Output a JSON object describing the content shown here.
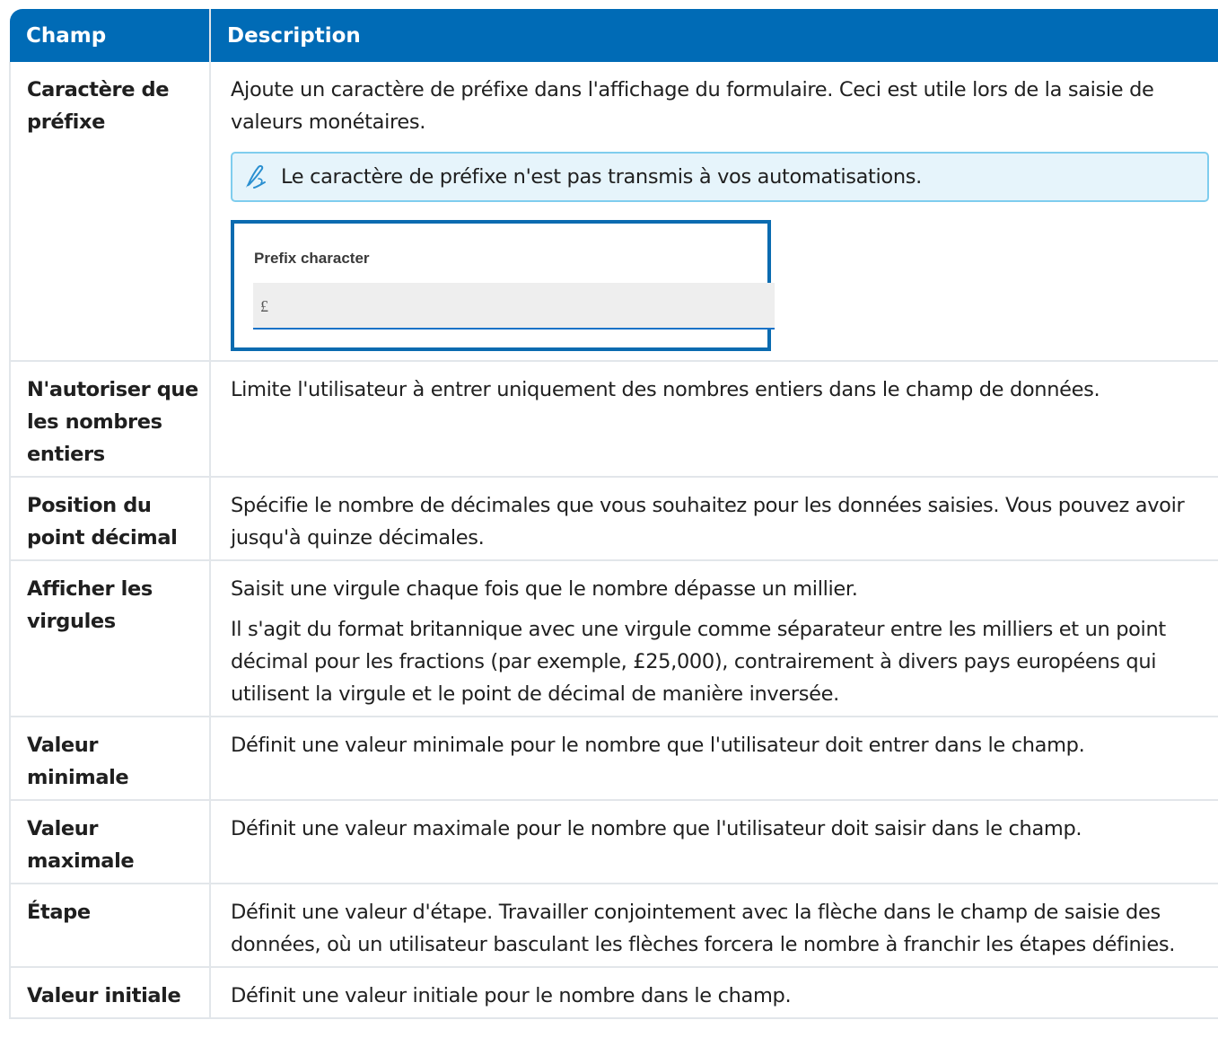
{
  "table": {
    "headers": [
      "Champ",
      "Description"
    ],
    "rows": [
      {
        "field": "Caractère de préfixe",
        "desc": [
          "Ajoute un caractère de préfixe dans l'affichage du formulaire. Ceci est utile lors de la saisie de valeurs monétaires."
        ],
        "note": "Le caractère de préfixe n'est pas transmis à vos automatisations.",
        "example": {
          "label": "Prefix character",
          "value": "£"
        }
      },
      {
        "field": "N'autoriser que les nombres entiers",
        "desc": [
          "Limite l'utilisateur à entrer uniquement des nombres entiers dans le champ de données."
        ]
      },
      {
        "field": "Position du point décimal",
        "desc": [
          "Spécifie le nombre de décimales que vous souhaitez pour les données saisies. Vous pouvez avoir jusqu'à quinze décimales."
        ]
      },
      {
        "field": "Afficher les virgules",
        "desc": [
          "Saisit une virgule chaque fois que le nombre dépasse un millier.",
          "Il s'agit du format britannique avec une virgule comme séparateur entre les milliers et un point décimal pour les fractions (par exemple, £25,000), contrairement à divers pays européens qui utilisent la virgule et le point de décimal de manière inversée."
        ]
      },
      {
        "field": "Valeur minimale",
        "desc": [
          "Définit une valeur minimale pour le nombre que l'utilisateur doit entrer dans le champ."
        ]
      },
      {
        "field": "Valeur maximale",
        "desc": [
          "Définit une valeur maximale pour le nombre que l'utilisateur doit saisir dans le champ."
        ]
      },
      {
        "field": "Étape",
        "desc": [
          "Définit une valeur d'étape. Travailler conjointement avec la flèche dans le champ de saisie des données, où un utilisateur basculant les flèches forcera le nombre à franchir les étapes définies."
        ]
      },
      {
        "field": "Valeur initiale",
        "desc": [
          "Définit une valeur initiale pour le nombre dans le champ."
        ]
      }
    ]
  },
  "colors": {
    "header_bg": "#006bb6",
    "note_bg": "#e6f4fb",
    "note_border": "#7fcdee",
    "widget_border": "#0a6bb0"
  },
  "icons": {
    "note": "pen-icon"
  }
}
